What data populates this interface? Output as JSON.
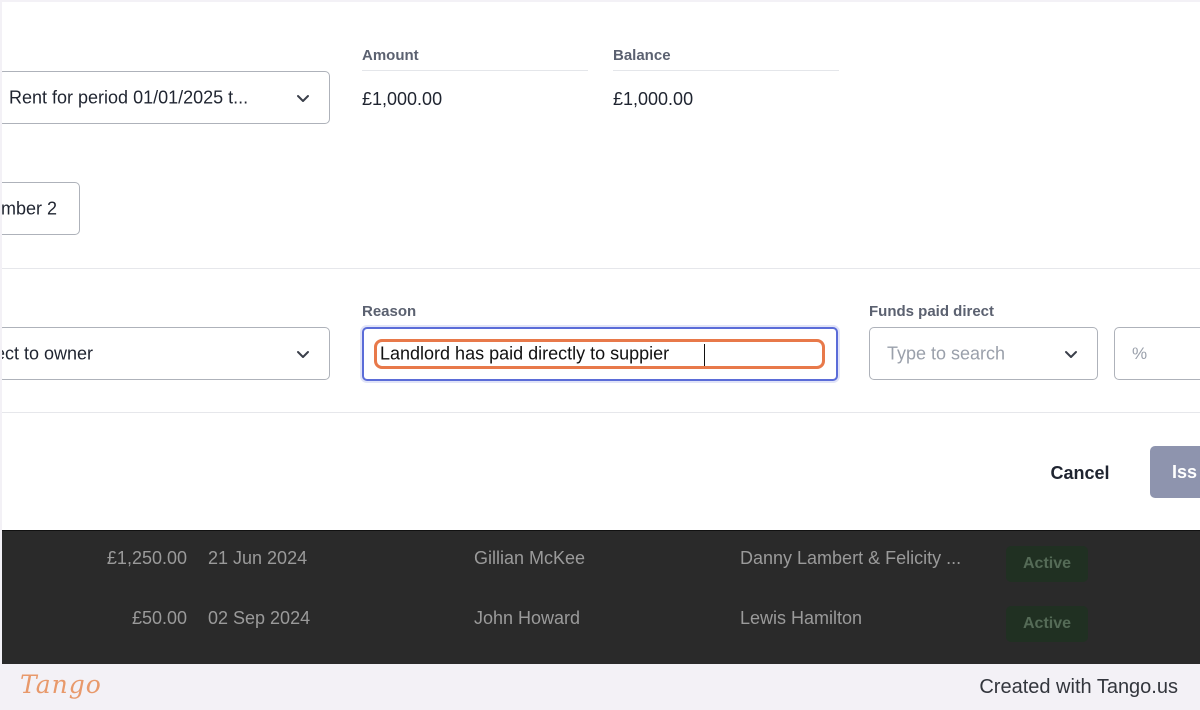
{
  "modal": {
    "item_select": {
      "value": "Rent for period 01/01/2025 t..."
    },
    "amount": {
      "label": "Amount",
      "value": "£1,000.00"
    },
    "balance": {
      "label": "Balance",
      "value": "£1,000.00"
    },
    "number_chip": {
      "value": "mber 2"
    },
    "type_select": {
      "value": "ect to owner"
    },
    "reason": {
      "label": "Reason",
      "value": "Landlord has paid directly to suppier"
    },
    "funds_paid_direct": {
      "label": "Funds paid direct",
      "placeholder": "Type to search"
    },
    "percent_field": {
      "placeholder": "%"
    },
    "actions": {
      "cancel_label": "Cancel",
      "issue_label": "Iss"
    }
  },
  "background_table": {
    "rows": [
      {
        "amount": "£1,250.00",
        "date": "21 Jun 2024",
        "agent": "Gillian McKee",
        "tenant": "Danny Lambert & Felicity ...",
        "status": "Active"
      },
      {
        "amount": "£50.00",
        "date": "02 Sep 2024",
        "agent": "John Howard",
        "tenant": "Lewis Hamilton",
        "status": "Active"
      }
    ]
  },
  "footer": {
    "logo": "Tango",
    "credit": "Created with Tango.us"
  },
  "colors": {
    "highlight": "#e8794a",
    "focus_border": "#5b6cd8",
    "primary_button": "#8e94ae",
    "status_badge_bg": "#203022"
  }
}
